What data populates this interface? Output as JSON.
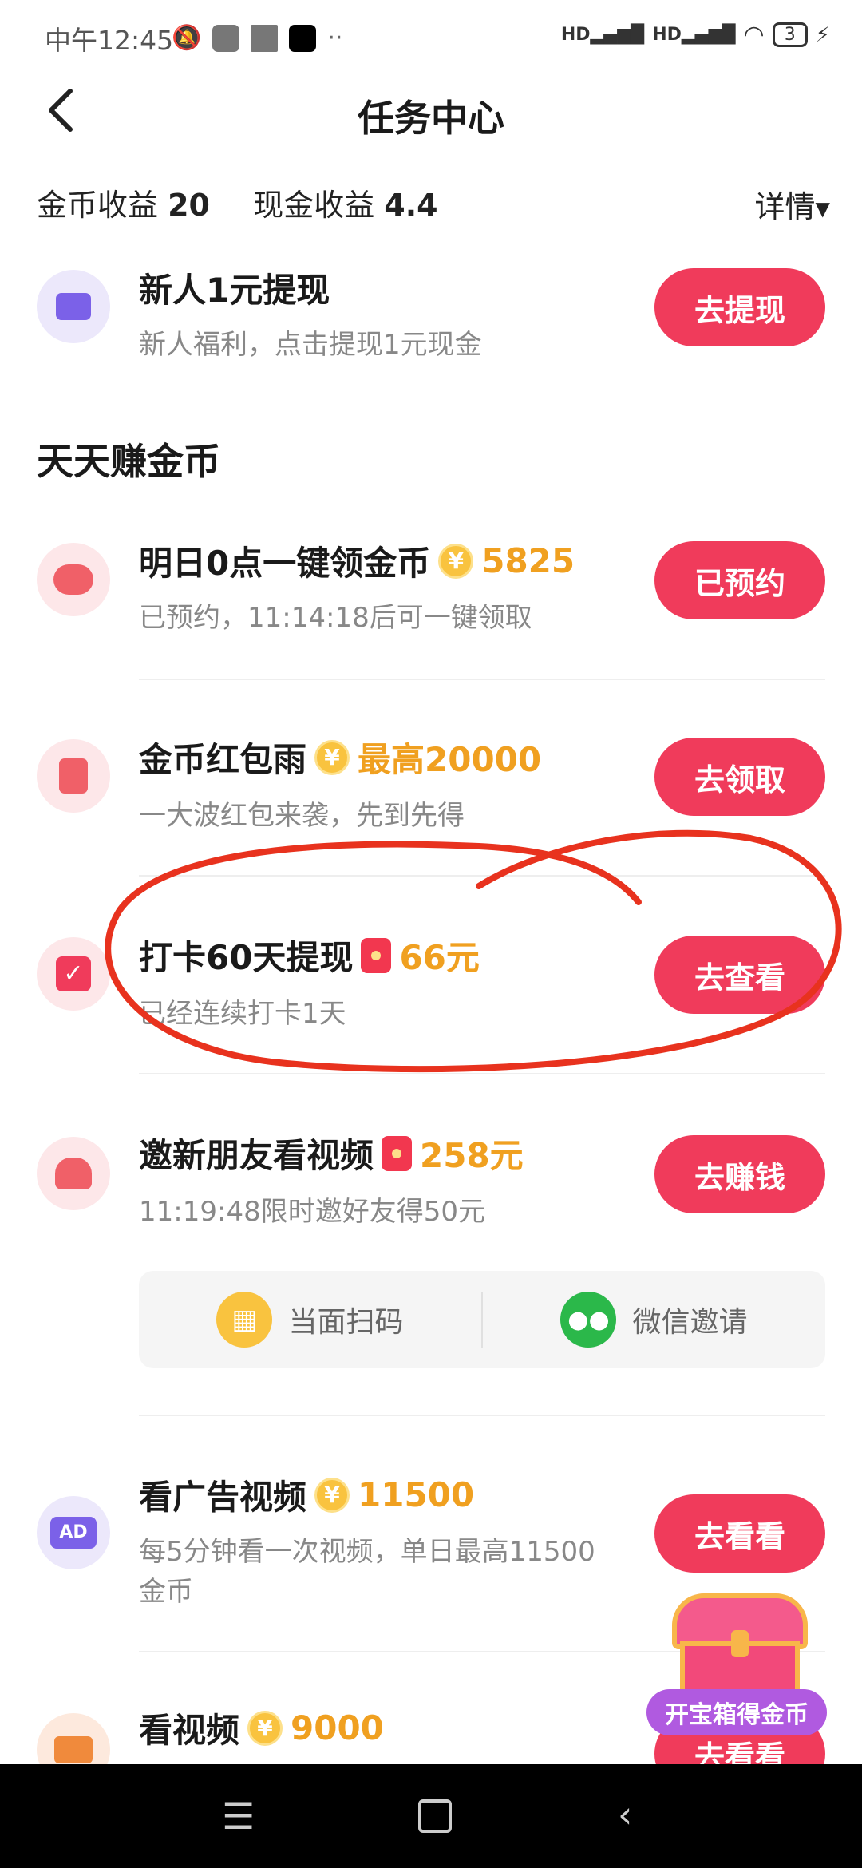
{
  "status": {
    "time": "中午12:45",
    "battery": "3"
  },
  "header": {
    "title": "任务中心"
  },
  "earnings": {
    "coin_label": "金币收益",
    "coin_value": "20",
    "cash_label": "现金收益",
    "cash_value": "4.4",
    "detail": "详情"
  },
  "newbie": {
    "title": "新人1元提现",
    "subtitle": "新人福利，点击提现1元现金",
    "button": "去提现"
  },
  "section_title": "天天赚金币",
  "tasks": [
    {
      "title": "明日0点一键领金币",
      "reward": "5825",
      "subtitle": "已预约，11:14:18后可一键领取",
      "button": "已预约"
    },
    {
      "title": "金币红包雨",
      "reward": "最高20000",
      "subtitle": "一大波红包来袭，先到先得",
      "button": "去领取"
    },
    {
      "title": "打卡60天提现",
      "reward": "66元",
      "subtitle": "已经连续打卡1天",
      "button": "去查看"
    },
    {
      "title": "邀新朋友看视频",
      "reward": "258元",
      "subtitle": "11:19:48限时邀好友得50元",
      "button": "去赚钱"
    },
    {
      "title": "看广告视频",
      "reward": "11500",
      "subtitle": "每5分钟看一次视频，单日最高11500",
      "subtitle2": "金币",
      "button": "去看看"
    },
    {
      "title": "看视频",
      "reward": "9000",
      "button": "去看看"
    }
  ],
  "invite": {
    "scan": "当面扫码",
    "wechat": "微信邀请"
  },
  "treasure": {
    "label": "开宝箱得金币"
  },
  "icons": {
    "ad": "AD"
  }
}
